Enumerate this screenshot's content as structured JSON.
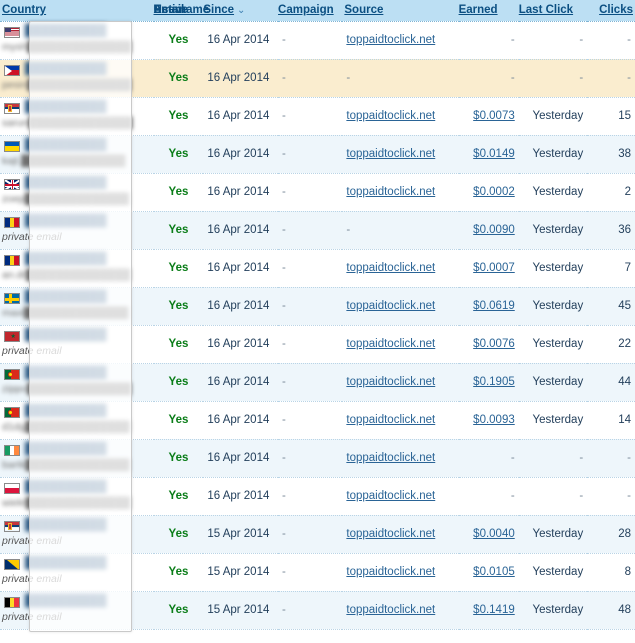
{
  "table": {
    "columns": [
      {
        "key": "country",
        "label": "Country",
        "sortable": true,
        "align": "left"
      },
      {
        "key": "username",
        "label": "Username",
        "sortable": true,
        "align": "left"
      },
      {
        "key": "email",
        "label": "Email",
        "sortable": true,
        "align": "left"
      },
      {
        "key": "active",
        "label": "Active",
        "sortable": true,
        "align": "center"
      },
      {
        "key": "since",
        "label": "Since",
        "sortable": true,
        "align": "left",
        "sort_indicator": "⌄"
      },
      {
        "key": "campaign",
        "label": "Campaign",
        "sortable": true,
        "align": "left"
      },
      {
        "key": "source",
        "label": "Source",
        "sortable": true,
        "align": "left"
      },
      {
        "key": "earned",
        "label": "Earned",
        "sortable": true,
        "align": "right"
      },
      {
        "key": "last_click",
        "label": "Last Click",
        "sortable": true,
        "align": "right"
      },
      {
        "key": "clicks",
        "label": "Clicks",
        "sortable": true,
        "align": "right"
      }
    ],
    "colors": {
      "header_bg": "#bcdff3",
      "header_link": "#0b4f82",
      "row_odd_bg": "#ffffff",
      "row_even_bg": "#eef6fb",
      "row_highlight_bg": "#faedcf",
      "active_yes": "#0a7d18",
      "link": "#2a6496",
      "border_dotted": "#b9d4e6"
    },
    "rows": [
      {
        "flag": "us",
        "flag_name": "flag-united-states",
        "username": "",
        "email": "mysh",
        "active": "Yes",
        "since": "16 Apr 2014",
        "campaign": "-",
        "source": "toppaidtoclick.net",
        "earned": "-",
        "last_click": "-",
        "clicks": "-",
        "stripe": "odd"
      },
      {
        "flag": "ph",
        "flag_name": "flag-philippines",
        "username": "",
        "email": "pesin",
        "active": "Yes",
        "since": "16 Apr 2014",
        "campaign": "-",
        "source": "-",
        "earned": "-",
        "last_click": "-",
        "clicks": "-",
        "stripe": "highlight"
      },
      {
        "flag": "rs",
        "flag_name": "flag-serbia",
        "username": "",
        "email": "sarun",
        "active": "Yes",
        "since": "16 Apr 2014",
        "campaign": "-",
        "source": "toppaidtoclick.net",
        "earned": "$0.0073",
        "last_click": "Yesterday",
        "clicks": "15",
        "stripe": "odd"
      },
      {
        "flag": "ua",
        "flag_name": "flag-ukraine",
        "username": "",
        "email": "kajt.",
        "active": "Yes",
        "since": "16 Apr 2014",
        "campaign": "-",
        "source": "toppaidtoclick.net",
        "earned": "$0.0149",
        "last_click": "Yesterday",
        "clicks": "38",
        "stripe": "even"
      },
      {
        "flag": "uk",
        "flag_name": "flag-united-kingdom",
        "username": "",
        "email": "zoep",
        "active": "Yes",
        "since": "16 Apr 2014",
        "campaign": "-",
        "source": "toppaidtoclick.net",
        "earned": "$0.0002",
        "last_click": "Yesterday",
        "clicks": "2",
        "stripe": "odd"
      },
      {
        "flag": "ro",
        "flag_name": "flag-romania",
        "username": "",
        "email": "private email",
        "email_plain": true,
        "active": "Yes",
        "since": "16 Apr 2014",
        "campaign": "-",
        "source": "-",
        "earned": "$0.0090",
        "last_click": "Yesterday",
        "clicks": "36",
        "stripe": "even"
      },
      {
        "flag": "ro",
        "flag_name": "flag-romania",
        "username": "",
        "email": "an.dr",
        "active": "Yes",
        "since": "16 Apr 2014",
        "campaign": "-",
        "source": "toppaidtoclick.net",
        "earned": "$0.0007",
        "last_click": "Yesterday",
        "clicks": "7",
        "stripe": "odd"
      },
      {
        "flag": "se",
        "flag_name": "flag-sweden",
        "username": "",
        "email": "maxi",
        "active": "Yes",
        "since": "16 Apr 2014",
        "campaign": "-",
        "source": "toppaidtoclick.net",
        "earned": "$0.0619",
        "last_click": "Yesterday",
        "clicks": "45",
        "stripe": "even"
      },
      {
        "flag": "ma",
        "flag_name": "flag-morocco",
        "username": "",
        "email": "private email",
        "email_plain": true,
        "active": "Yes",
        "since": "16 Apr 2014",
        "campaign": "-",
        "source": "toppaidtoclick.net",
        "earned": "$0.0076",
        "last_click": "Yesterday",
        "clicks": "22",
        "stripe": "odd"
      },
      {
        "flag": "pt",
        "flag_name": "flag-portugal",
        "username": "",
        "email": "zippo",
        "active": "Yes",
        "since": "16 Apr 2014",
        "campaign": "-",
        "source": "toppaidtoclick.net",
        "earned": "$0.1905",
        "last_click": "Yesterday",
        "clicks": "44",
        "stripe": "even"
      },
      {
        "flag": "pt",
        "flag_name": "flag-portugal",
        "username": "",
        "email": "d1dg",
        "active": "Yes",
        "since": "16 Apr 2014",
        "campaign": "-",
        "source": "toppaidtoclick.net",
        "earned": "$0.0093",
        "last_click": "Yesterday",
        "clicks": "14",
        "stripe": "odd"
      },
      {
        "flag": "ie",
        "flag_name": "flag-ireland",
        "username": "",
        "email": "bartk",
        "active": "Yes",
        "since": "16 Apr 2014",
        "campaign": "-",
        "source": "toppaidtoclick.net",
        "earned": "-",
        "last_click": "-",
        "clicks": "-",
        "stripe": "even"
      },
      {
        "flag": "pl",
        "flag_name": "flag-poland",
        "username": "",
        "email": "wiekt",
        "active": "Yes",
        "since": "16 Apr 2014",
        "campaign": "-",
        "source": "toppaidtoclick.net",
        "earned": "-",
        "last_click": "-",
        "clicks": "-",
        "stripe": "odd"
      },
      {
        "flag": "rs",
        "flag_name": "flag-serbia",
        "username": "",
        "email": "private email",
        "email_plain": true,
        "active": "Yes",
        "since": "15 Apr 2014",
        "campaign": "-",
        "source": "toppaidtoclick.net",
        "earned": "$0.0040",
        "last_click": "Yesterday",
        "clicks": "28",
        "stripe": "even"
      },
      {
        "flag": "ba",
        "flag_name": "flag-bosnia-herzegovina",
        "username": "",
        "email": "private email",
        "email_plain": true,
        "active": "Yes",
        "since": "15 Apr 2014",
        "campaign": "-",
        "source": "toppaidtoclick.net",
        "earned": "$0.0105",
        "last_click": "Yesterday",
        "clicks": "8",
        "stripe": "odd"
      },
      {
        "flag": "be",
        "flag_name": "flag-belgium",
        "username": "",
        "email": "private email",
        "email_plain": true,
        "active": "Yes",
        "since": "15 Apr 2014",
        "campaign": "-",
        "source": "toppaidtoclick.net",
        "earned": "$0.1419",
        "last_click": "Yesterday",
        "clicks": "48",
        "stripe": "even"
      }
    ]
  },
  "overlay": {
    "name": "redaction-overlay-panel",
    "present": true
  }
}
